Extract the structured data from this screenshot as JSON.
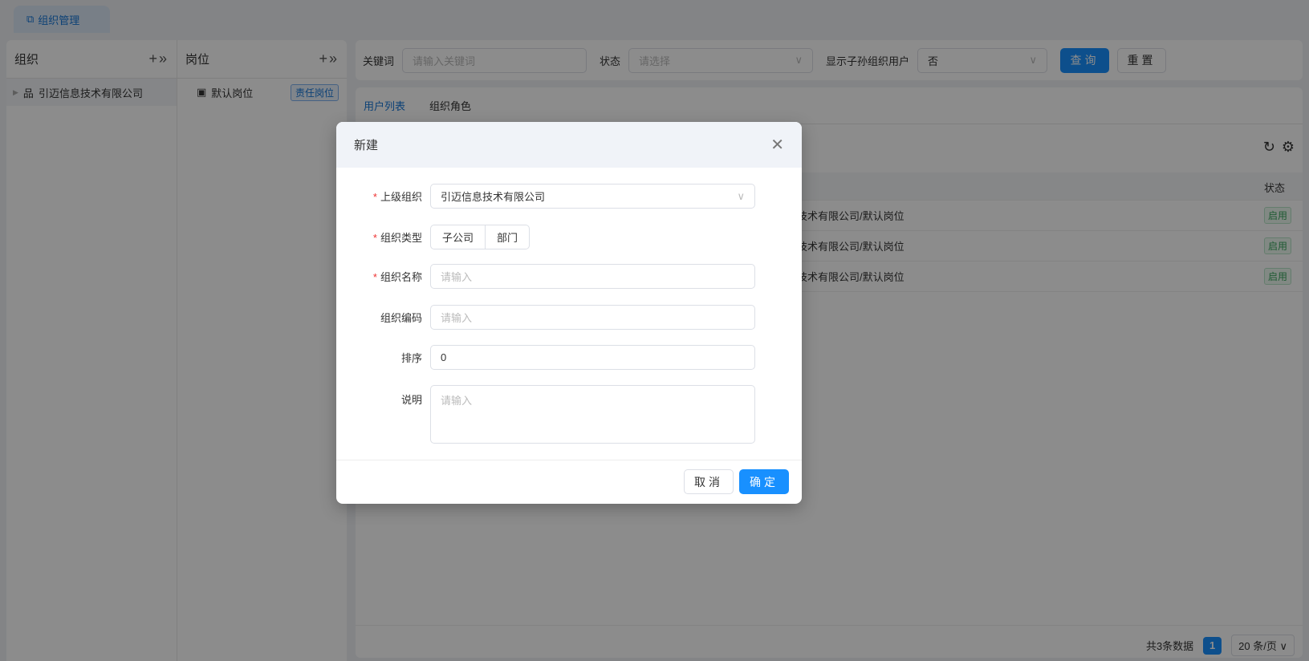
{
  "top_tab": {
    "label": "组织管理",
    "icon": "org-tree-icon"
  },
  "org_panel": {
    "title": "组织",
    "items": [
      {
        "label": "引迈信息技术有限公司"
      }
    ]
  },
  "position_panel": {
    "title": "岗位",
    "items": [
      {
        "label": "默认岗位",
        "tag": "责任岗位"
      }
    ]
  },
  "filters": {
    "keyword_label": "关键词",
    "keyword_placeholder": "请输入关键词",
    "status_label": "状态",
    "status_placeholder": "请选择",
    "sub_label": "显示子孙组织用户",
    "sub_value": "否",
    "query": "查询",
    "reset": "重置"
  },
  "tabs": [
    {
      "label": "用户列表",
      "active": true
    },
    {
      "label": "组织角色"
    }
  ],
  "table": {
    "status_header": "状态",
    "rows": [
      {
        "path": "技术有限公司/默认岗位",
        "status": "启用"
      },
      {
        "path": "技术有限公司/默认岗位",
        "status": "启用"
      },
      {
        "path": "技术有限公司/默认岗位",
        "status": "启用"
      }
    ]
  },
  "pagination": {
    "total": "共3条数据",
    "page": "1",
    "page_size": "20 条/页"
  },
  "dialog": {
    "title": "新建",
    "fields": {
      "parent": {
        "label": "上级组织",
        "value": "引迈信息技术有限公司"
      },
      "type": {
        "label": "组织类型",
        "options": [
          "子公司",
          "部门"
        ]
      },
      "name": {
        "label": "组织名称",
        "placeholder": "请输入"
      },
      "code": {
        "label": "组织编码",
        "placeholder": "请输入"
      },
      "sort": {
        "label": "排序",
        "value": "0"
      },
      "desc": {
        "label": "说明",
        "placeholder": "请输入"
      }
    },
    "cancel": "取消",
    "ok": "确定"
  },
  "colors": {
    "primary": "#1890ff",
    "success": "#3aa55d"
  }
}
